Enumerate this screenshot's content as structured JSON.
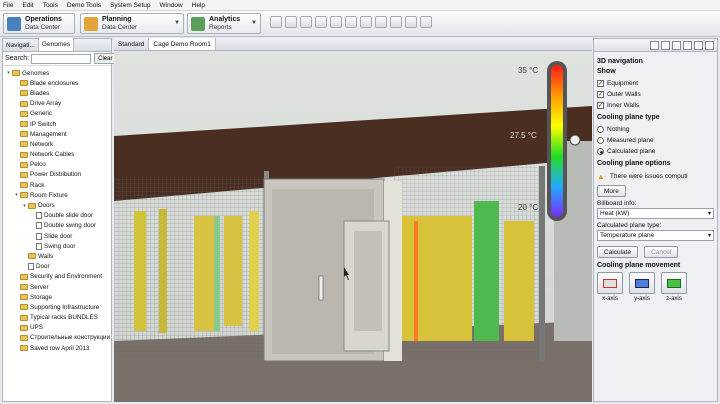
{
  "menu": [
    "File",
    "Edit",
    "Tools",
    "Demo Tools",
    "System Setup",
    "Window",
    "Help"
  ],
  "perspectives": [
    {
      "title": "Operations",
      "subtitle": "Data Center"
    },
    {
      "title": "Planning",
      "subtitle": "Data Center"
    },
    {
      "title": "Analytics",
      "subtitle": "Reports"
    }
  ],
  "left_tabs": [
    "Navigati...",
    "Genomes"
  ],
  "search": {
    "label": "Search:",
    "value": "",
    "clear": "Clear"
  },
  "tree": [
    {
      "label": "Genomes",
      "depth": 0,
      "icon": "folder"
    },
    {
      "label": "Blade enclosures",
      "depth": 1,
      "icon": "folder"
    },
    {
      "label": "Blades",
      "depth": 1,
      "icon": "folder"
    },
    {
      "label": "Drive Array",
      "depth": 1,
      "icon": "folder"
    },
    {
      "label": "Generic",
      "depth": 1,
      "icon": "folder"
    },
    {
      "label": "IP Switch",
      "depth": 1,
      "icon": "folder"
    },
    {
      "label": "Management",
      "depth": 1,
      "icon": "folder"
    },
    {
      "label": "Network",
      "depth": 1,
      "icon": "folder"
    },
    {
      "label": "Network Cables",
      "depth": 1,
      "icon": "folder"
    },
    {
      "label": "Pelco",
      "depth": 1,
      "icon": "folder"
    },
    {
      "label": "Power Distribution",
      "depth": 1,
      "icon": "folder"
    },
    {
      "label": "Rack",
      "depth": 1,
      "icon": "folder"
    },
    {
      "label": "Room Fixture",
      "depth": 1,
      "icon": "folder"
    },
    {
      "label": "Doors",
      "depth": 2,
      "icon": "folder"
    },
    {
      "label": "Double slide door",
      "depth": 3,
      "icon": "doc"
    },
    {
      "label": "Double swing door",
      "depth": 3,
      "icon": "doc"
    },
    {
      "label": "Slide door",
      "depth": 3,
      "icon": "doc"
    },
    {
      "label": "Swing door",
      "depth": 3,
      "icon": "doc"
    },
    {
      "label": "Walls",
      "depth": 2,
      "icon": "folder"
    },
    {
      "label": "Door",
      "depth": 2,
      "icon": "doc"
    },
    {
      "label": "Security and Environment",
      "depth": 1,
      "icon": "folder"
    },
    {
      "label": "Server",
      "depth": 1,
      "icon": "folder"
    },
    {
      "label": "Storage",
      "depth": 1,
      "icon": "folder"
    },
    {
      "label": "Supporting Infrastructure",
      "depth": 1,
      "icon": "folder"
    },
    {
      "label": "Typical racks BUNDLES",
      "depth": 1,
      "icon": "folder"
    },
    {
      "label": "UPS",
      "depth": 1,
      "icon": "folder"
    },
    {
      "label": "Строительные конструкции",
      "depth": 1,
      "icon": "folder"
    },
    {
      "label": "Saved row April 2013",
      "depth": 1,
      "icon": "folder"
    }
  ],
  "view_tabs": [
    "Standard",
    "Cage Demo Room1"
  ],
  "scale": {
    "max": "35 °C",
    "mid": "27.5 °C",
    "min": "20 °C"
  },
  "nav": {
    "title": "3D navigation",
    "show_heading": "Show",
    "show_items": [
      {
        "label": "Equipment",
        "checked": true
      },
      {
        "label": "Outer Walls",
        "checked": true
      },
      {
        "label": "Inner Walls",
        "checked": true
      }
    ],
    "cooling_type_heading": "Cooling plane type",
    "cooling_types": [
      {
        "label": "Nothing",
        "selected": false
      },
      {
        "label": "Measured plane",
        "selected": false
      },
      {
        "label": "Calculated plane",
        "selected": true
      }
    ],
    "options_heading": "Cooling plane options",
    "warning": "There were issues computi",
    "more": "More",
    "billboard_label": "Billboard info:",
    "billboard_value": "Heat (kW)",
    "calc_type_label": "Calculated plane type:",
    "calc_type_value": "Temperature plane",
    "calculate": "Calculate",
    "cancel": "Cancel",
    "movement_heading": "Cooling plane movement",
    "axes": [
      "x-axis",
      "y-axis",
      "z-axis"
    ]
  }
}
